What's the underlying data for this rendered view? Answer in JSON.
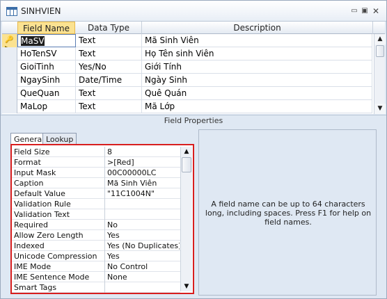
{
  "window": {
    "title": "SINHVIEN",
    "minimize_glyph": "▭",
    "restore_glyph": "▣",
    "close_glyph": "✕"
  },
  "grid": {
    "headers": {
      "field_name": "Field Name",
      "data_type": "Data Type",
      "description": "Description"
    },
    "rows": [
      {
        "field_name": "MaSV",
        "data_type": "Text",
        "description": "Mã Sinh Viên",
        "primary_key": true
      },
      {
        "field_name": "HoTenSV",
        "data_type": "Text",
        "description": "Họ Tên sinh Viên"
      },
      {
        "field_name": "GioiTinh",
        "data_type": "Yes/No",
        "description": "Giới Tính"
      },
      {
        "field_name": "NgaySinh",
        "data_type": "Date/Time",
        "description": "Ngày Sinh"
      },
      {
        "field_name": "QueQuan",
        "data_type": "Text",
        "description": "Quê Quán"
      },
      {
        "field_name": "MaLop",
        "data_type": "Text",
        "description": "Mã Lớp"
      }
    ]
  },
  "field_properties": {
    "bar_label": "Field Properties",
    "tabs": [
      "General",
      "Lookup"
    ],
    "active_tab": "General",
    "rows": [
      {
        "label": "Field Size",
        "value": "8"
      },
      {
        "label": "Format",
        "value": ">[Red]"
      },
      {
        "label": "Input Mask",
        "value": "00C00000LC"
      },
      {
        "label": "Caption",
        "value": "Mã Sinh Viên"
      },
      {
        "label": "Default Value",
        "value": "\"11C1004N\""
      },
      {
        "label": "Validation Rule",
        "value": ""
      },
      {
        "label": "Validation Text",
        "value": ""
      },
      {
        "label": "Required",
        "value": "No"
      },
      {
        "label": "Allow Zero Length",
        "value": "Yes"
      },
      {
        "label": "Indexed",
        "value": "Yes (No Duplicates)"
      },
      {
        "label": "Unicode Compression",
        "value": "Yes"
      },
      {
        "label": "IME Mode",
        "value": "No Control"
      },
      {
        "label": "IME Sentence Mode",
        "value": "None"
      },
      {
        "label": "Smart Tags",
        "value": ""
      }
    ]
  },
  "help": {
    "text": "A field name can be up to 64 characters long, including spaces. Press F1 for help on field names."
  },
  "colors": {
    "highlight_border": "#d81e1e",
    "selected_header": "#fbe291"
  }
}
